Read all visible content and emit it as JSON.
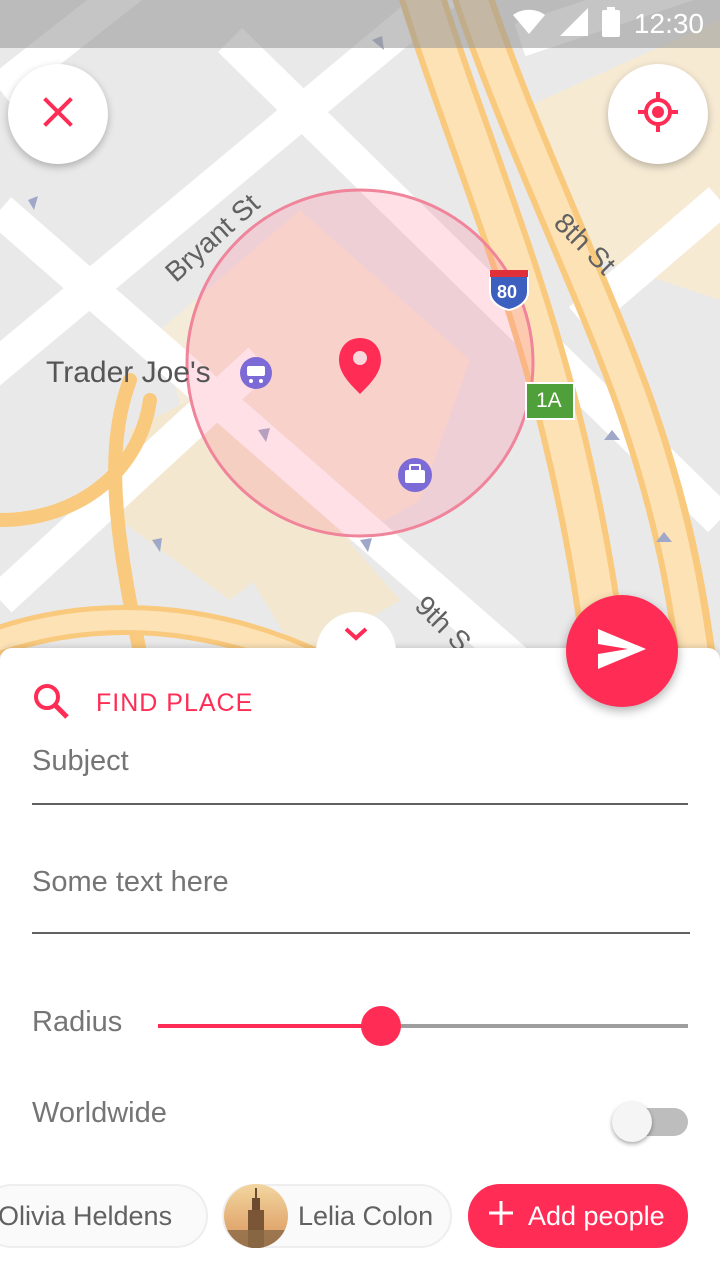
{
  "status_bar": {
    "time": "12:30",
    "icons": [
      "wifi-icon",
      "signal-icon",
      "battery-icon"
    ]
  },
  "map": {
    "labels": {
      "bryant": "Bryant St",
      "eighth": "8th St",
      "ninth": "9th S",
      "poi": "Trader Joe's",
      "interstate": "80",
      "exit": "1A"
    }
  },
  "actions": {
    "close": "close-icon",
    "locate": "my-location-icon",
    "send": "send-icon",
    "collapse": "chevron-down-icon"
  },
  "find_place": {
    "label": "FIND PLACE",
    "icon": "search-icon"
  },
  "form": {
    "subject_placeholder": "Subject",
    "text_value": "Some text here",
    "radius_label": "Radius",
    "radius_value": 0.42,
    "worldwide_label": "Worldwide",
    "worldwide_on": false
  },
  "people": {
    "chips": [
      {
        "name": "Olivia Heldens"
      },
      {
        "name": "Lelia Colon"
      }
    ],
    "add_label": "Add people"
  },
  "colors": {
    "accent": "#ff2d55",
    "road": "#fdd08a",
    "map_bg": "#e8e8e8"
  }
}
